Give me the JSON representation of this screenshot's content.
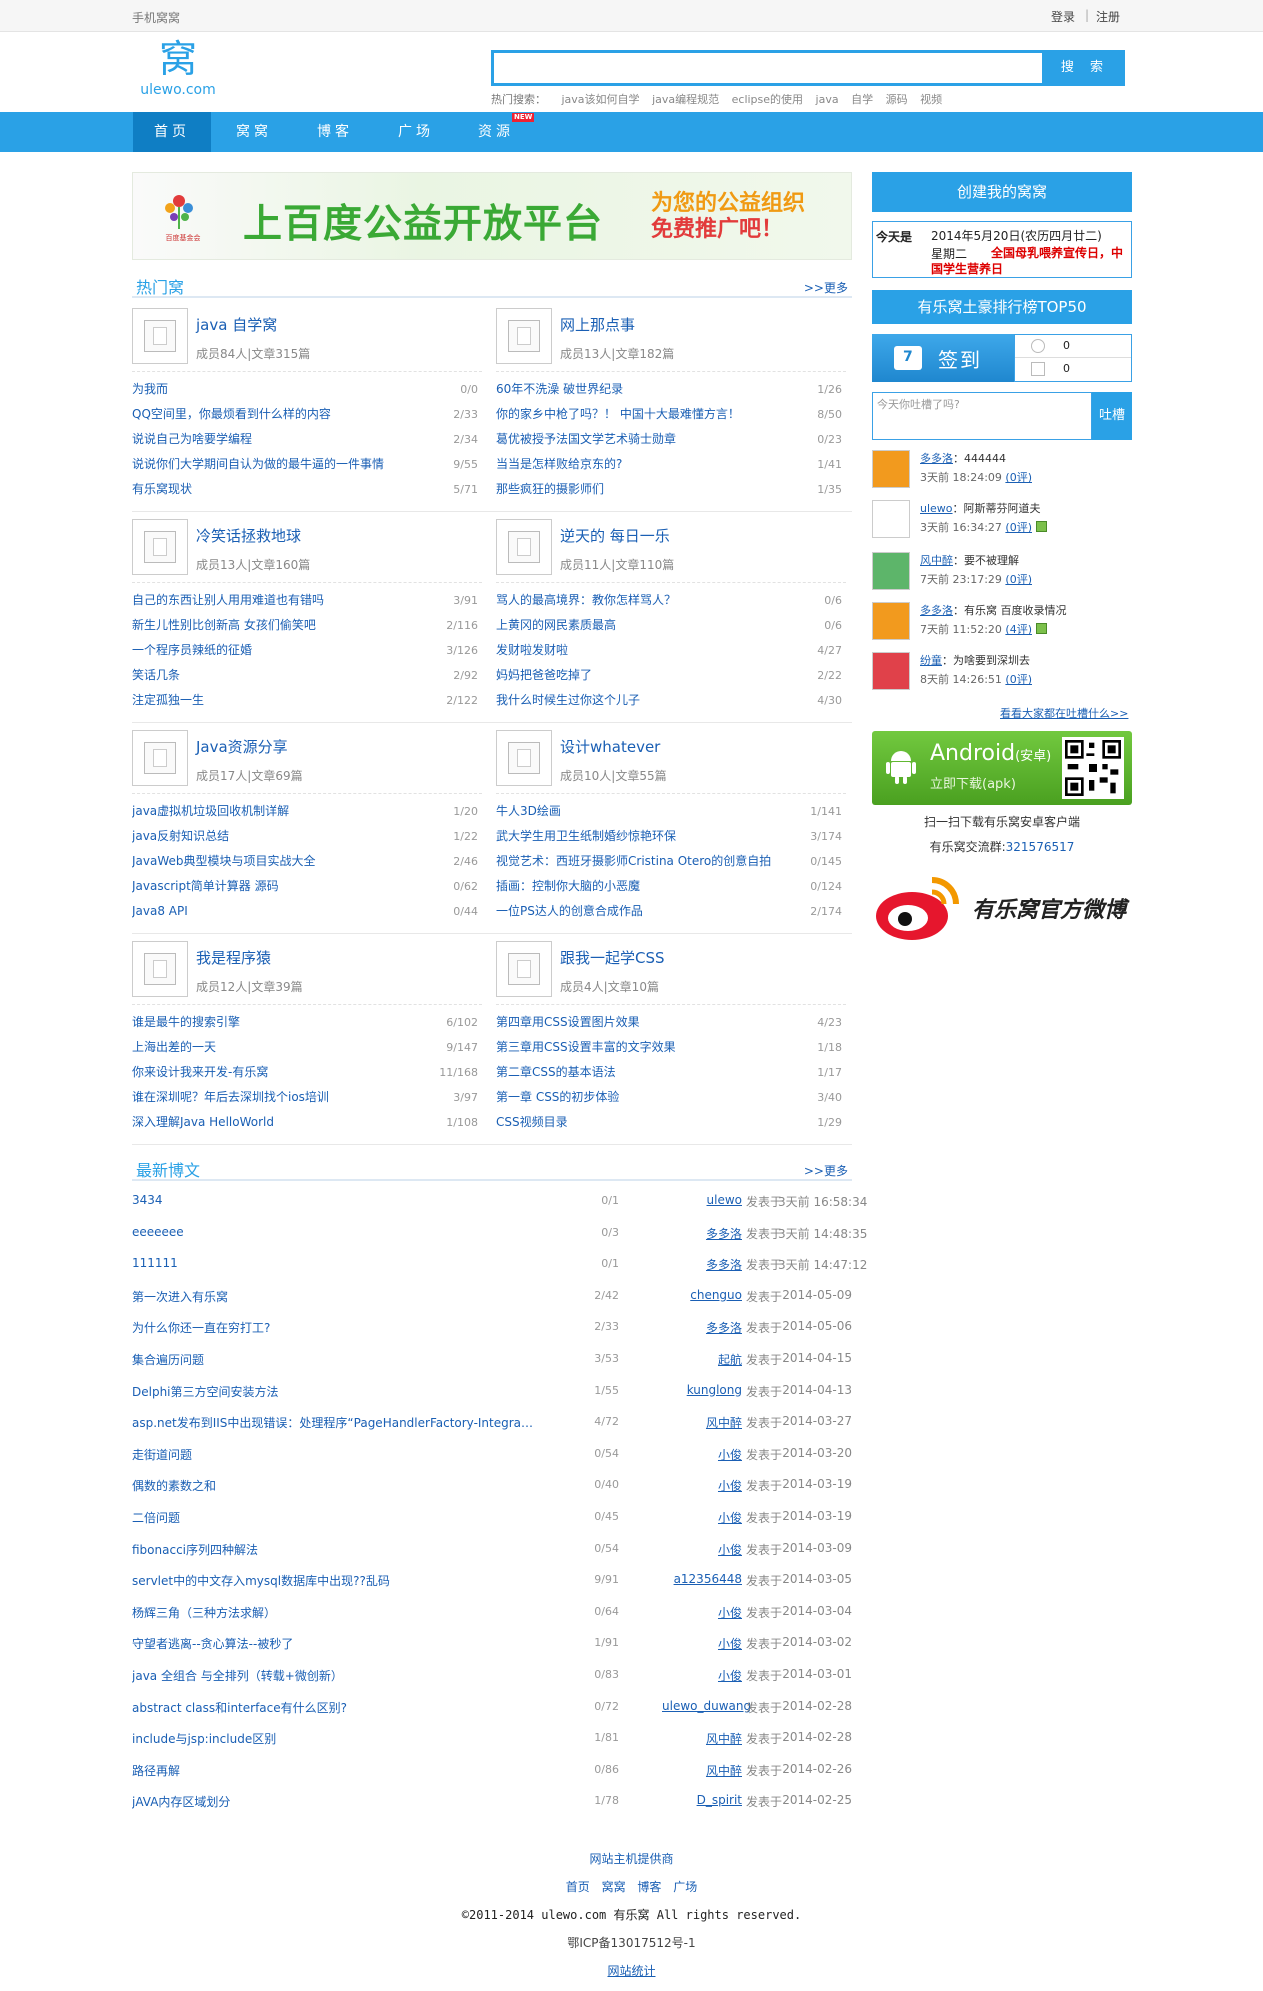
{
  "topbar": {
    "mobile": "手机窝窝",
    "login": "登录",
    "sep": "|",
    "register": "注册"
  },
  "logo": {
    "char": "窝",
    "domain": "ulewo.com"
  },
  "search": {
    "placeholder": "",
    "button": "搜 索",
    "hot_label": "热门搜索：",
    "hot": [
      "java该如何自学",
      "java编程规范",
      "eclipse的使用",
      "java",
      "自学",
      "源码",
      "视频"
    ]
  },
  "nav": {
    "items": [
      "首页",
      "窝窝",
      "博客",
      "广场",
      "资源"
    ],
    "new_badge": "NEW"
  },
  "banner": {
    "fund": "百度基金会",
    "title": "上百度公益开放平台",
    "slogan1": "为您的公益组织",
    "slogan2": "免费推广吧！"
  },
  "hot_groups": {
    "title": "热门窝",
    "more": ">>更多"
  },
  "groups": [
    {
      "name": "java 自学窝",
      "meta": "成员84人|文章315篇",
      "posts": [
        [
          "为我而",
          "0/0"
        ],
        [
          "QQ空间里，你最烦看到什么样的内容",
          "2/33"
        ],
        [
          "说说自己为啥要学编程",
          "2/34"
        ],
        [
          "说说你们大学期间自认为做的最牛逼的一件事情",
          "9/55"
        ],
        [
          "有乐窝现状",
          "5/71"
        ]
      ]
    },
    {
      "name": "网上那点事",
      "meta": "成员13人|文章182篇",
      "posts": [
        [
          "60年不洗澡 破世界纪录",
          "1/26"
        ],
        [
          "你的家乡中枪了吗？！ 中国十大最难懂方言！",
          "8/50"
        ],
        [
          "葛优被授予法国文学艺术骑士勋章",
          "0/23"
        ],
        [
          "当当是怎样败给京东的?",
          "1/41"
        ],
        [
          "那些疯狂的摄影师们",
          "1/35"
        ]
      ]
    },
    {
      "name": "冷笑话拯救地球",
      "meta": "成员13人|文章160篇",
      "posts": [
        [
          "自己的东西让别人用用难道也有错吗",
          "3/91"
        ],
        [
          "新生儿性别比创新高 女孩们偷笑吧",
          "2/116"
        ],
        [
          "一个程序员辣纸的征婚",
          "3/126"
        ],
        [
          "笑话几条",
          "2/92"
        ],
        [
          "注定孤独一生",
          "2/122"
        ]
      ]
    },
    {
      "name": "逆天的 每日一乐",
      "meta": "成员11人|文章110篇",
      "posts": [
        [
          "骂人的最高境界：教你怎样骂人？",
          "0/6"
        ],
        [
          "上黄冈的网民素质最高",
          "0/6"
        ],
        [
          "发财啦发财啦",
          "4/27"
        ],
        [
          "妈妈把爸爸吃掉了",
          "2/22"
        ],
        [
          "我什么时候生过你这个儿子",
          "4/30"
        ]
      ]
    },
    {
      "name": "Java资源分享",
      "meta": "成员17人|文章69篇",
      "posts": [
        [
          "java虚拟机垃圾回收机制详解",
          "1/20"
        ],
        [
          "java反射知识总结",
          "1/22"
        ],
        [
          "JavaWeb典型模块与项目实战大全",
          "2/46"
        ],
        [
          "Javascript简单计算器 源码",
          "0/62"
        ],
        [
          "Java8 API",
          "0/44"
        ]
      ]
    },
    {
      "name": "设计whatever",
      "meta": "成员10人|文章55篇",
      "posts": [
        [
          "牛人3D绘画",
          "1/141"
        ],
        [
          "武大学生用卫生纸制婚纱惊艳环保",
          "3/174"
        ],
        [
          "视觉艺术：西班牙摄影师Cristina Otero的创意自拍",
          "0/145"
        ],
        [
          "插画：控制你大脑的小恶魔",
          "0/124"
        ],
        [
          "一位PS达人的创意合成作品",
          "2/174"
        ]
      ]
    },
    {
      "name": "我是程序猿",
      "meta": "成员12人|文章39篇",
      "posts": [
        [
          "谁是最牛的搜索引擎",
          "6/102"
        ],
        [
          "上海出差的一天",
          "9/147"
        ],
        [
          "你来设计我来开发-有乐窝",
          "11/168"
        ],
        [
          "谁在深圳呢？年后去深圳找个ios培训",
          "3/97"
        ],
        [
          "深入理解Java HelloWorld",
          "1/108"
        ]
      ]
    },
    {
      "name": "跟我一起学CSS",
      "meta": "成员4人|文章10篇",
      "posts": [
        [
          "第四章用CSS设置图片效果",
          "4/23"
        ],
        [
          "第三章用CSS设置丰富的文字效果",
          "1/18"
        ],
        [
          "第二章CSS的基本语法",
          "1/17"
        ],
        [
          "第一章 CSS的初步体验",
          "3/40"
        ],
        [
          "CSS视频目录",
          "1/29"
        ]
      ]
    }
  ],
  "latest": {
    "title": "最新博文",
    "more": ">>更多",
    "published": "发表于"
  },
  "posts": [
    {
      "title": "3434",
      "count": "0/1",
      "author": "ulewo",
      "time": "3天前 16:58:34"
    },
    {
      "title": "eeeeeee",
      "count": "0/3",
      "author": "多多洛",
      "time": "3天前 14:48:35"
    },
    {
      "title": "111111",
      "count": "0/1",
      "author": "多多洛",
      "time": "3天前 14:47:12"
    },
    {
      "title": "第一次进入有乐窝",
      "count": "2/42",
      "author": "chenguo",
      "time": "2014-05-09"
    },
    {
      "title": "为什么你还一直在穷打工?",
      "count": "2/33",
      "author": "多多洛",
      "time": "2014-05-06"
    },
    {
      "title": "集合遍历问题",
      "count": "3/53",
      "author": "起航",
      "time": "2014-04-15"
    },
    {
      "title": "Delphi第三方空间安装方法",
      "count": "1/55",
      "author": "kunglong",
      "time": "2014-04-13"
    },
    {
      "title": "asp.net发布到IIS中出现错误：处理程序“PageHandlerFactory-Integrated”",
      "count": "4/72",
      "author": "风中醉",
      "time": "2014-03-27"
    },
    {
      "title": "走街道问题",
      "count": "0/54",
      "author": "小俊",
      "time": "2014-03-20"
    },
    {
      "title": "偶数的素数之和",
      "count": "0/40",
      "author": "小俊",
      "time": "2014-03-19"
    },
    {
      "title": "二倍问题",
      "count": "0/45",
      "author": "小俊",
      "time": "2014-03-19"
    },
    {
      "title": "fibonacci序列四种解法",
      "count": "0/54",
      "author": "小俊",
      "time": "2014-03-09"
    },
    {
      "title": "servlet中的中文存入mysql数据库中出现??乱码",
      "count": "9/91",
      "author": "a12356448",
      "time": "2014-03-05"
    },
    {
      "title": "杨辉三角（三种方法求解）",
      "count": "0/64",
      "author": "小俊",
      "time": "2014-03-04"
    },
    {
      "title": "守望者逃离--贪心算法--被秒了",
      "count": "1/91",
      "author": "小俊",
      "time": "2014-03-02"
    },
    {
      "title": "java 全组合 与全排列（转载+微创新）",
      "count": "0/83",
      "author": "小俊",
      "time": "2014-03-01"
    },
    {
      "title": "abstract class和interface有什么区别?",
      "count": "0/72",
      "author": "ulewo_duwang",
      "time": "2014-02-28"
    },
    {
      "title": "include与jsp:include区别",
      "count": "1/81",
      "author": "风中醉",
      "time": "2014-02-28"
    },
    {
      "title": "路径再解",
      "count": "0/86",
      "author": "风中醉",
      "time": "2014-02-26"
    },
    {
      "title": "jAVA内存区域划分",
      "count": "1/78",
      "author": "D_spirit",
      "time": "2014-02-25"
    }
  ],
  "sidebar": {
    "create": "创建我的窝窝",
    "cal_today": "今天是",
    "cal_date": "2014年5月20日(农历四月廿二)",
    "cal_week": "星期二",
    "cal_fest": "全国母乳喂养宣传日，中国学生营养日",
    "rank": "有乐窝土豪排行榜TOP50",
    "signin": "签到",
    "sign_counts": [
      "0",
      "0"
    ],
    "tucao_placeholder": "今天你吐槽了吗?",
    "tucao_btn": "吐槽",
    "tucao": [
      {
        "user": "多多洛",
        "text": "：444444",
        "time": "3天前 18:24:09",
        "reply": "(0评)",
        "emoji": false,
        "accent": "#f29a1e"
      },
      {
        "user": "ulewo",
        "text": "：阿斯蒂芬阿道夫",
        "time": "3天前 16:34:27",
        "reply": "(0评)",
        "emoji": true,
        "accent": "#ffffff"
      },
      {
        "user": "风中醉",
        "text": "：要不被理解",
        "time": "7天前 23:17:29",
        "reply": "(0评)",
        "emoji": false,
        "accent": "#5db56a"
      },
      {
        "user": "多多洛",
        "text": "：有乐窝 百度收录情况",
        "time": "7天前 11:52:20",
        "reply": "(4评)",
        "emoji": true,
        "accent": "#f29a1e"
      },
      {
        "user": "纷童",
        "text": "：为啥要到深圳去",
        "time": "8天前 14:26:51",
        "reply": "(0评)",
        "emoji": false,
        "accent": "#e0414a"
      }
    ],
    "see_all": "看看大家都在吐槽什么>>",
    "android_title": "Android",
    "android_sub": "(安卓)",
    "android_dl": "立即下载(apk)",
    "scan": "扫一扫下载有乐窝安卓客户端",
    "qq_label": "有乐窝交流群:",
    "qq_num": "321576517",
    "weibo": "有乐窝官方微博"
  },
  "footer": {
    "host": "网站主机提供商",
    "links": [
      "首页",
      "窝窝",
      "博客",
      "广场"
    ],
    "copy": "©2011-2014  ulewo.com 有乐窝  All rights reserved.",
    "icp": "鄂ICP备13017512号-1",
    "stat": "网站统计"
  }
}
